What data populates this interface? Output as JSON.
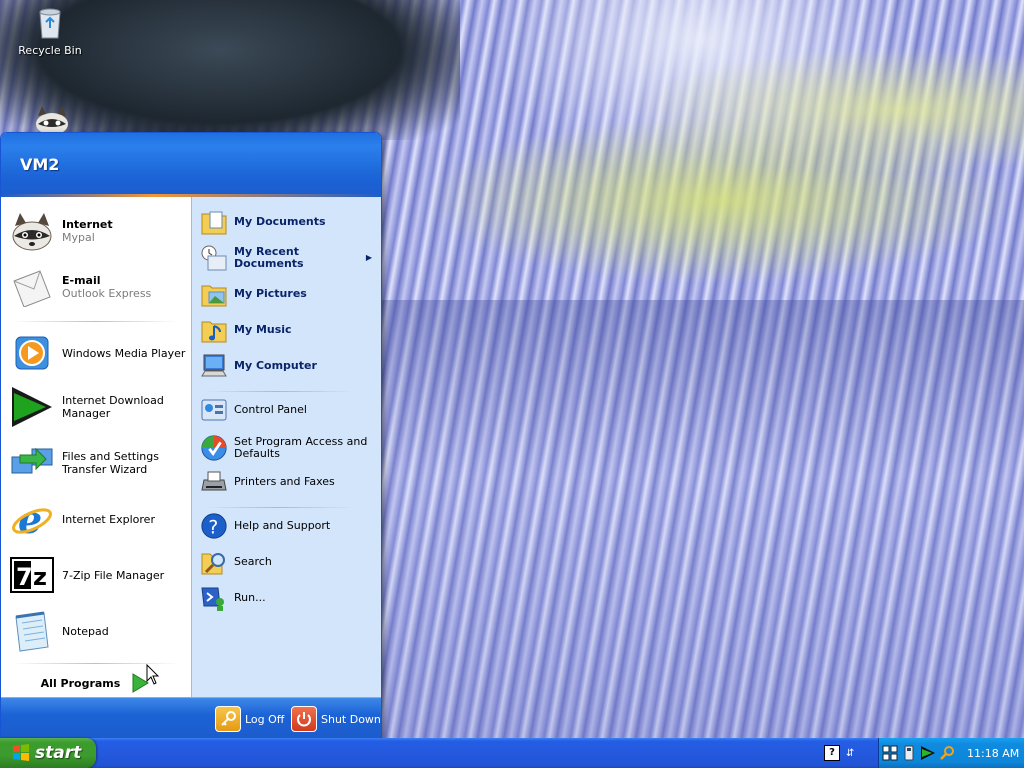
{
  "desktop": {
    "icons": [
      {
        "label": "Recycle Bin",
        "icon": "recycle-bin-icon"
      },
      {
        "label": "",
        "icon": "raccoon-icon"
      }
    ]
  },
  "start_menu": {
    "user_name": "VM2",
    "pinned": [
      {
        "title": "Internet",
        "subtitle": "Mypal",
        "icon": "raccoon-browser-icon"
      },
      {
        "title": "E-mail",
        "subtitle": "Outlook Express",
        "icon": "email-envelope-icon"
      }
    ],
    "recent": [
      {
        "label": "Windows Media Player",
        "icon": "media-player-icon"
      },
      {
        "label": "Internet Download Manager",
        "icon": "download-manager-icon"
      },
      {
        "label": "Files and Settings Transfer Wizard",
        "icon": "transfer-wizard-icon"
      },
      {
        "label": "Internet Explorer",
        "icon": "internet-explorer-icon"
      },
      {
        "label": "7-Zip File Manager",
        "icon": "7zip-icon"
      },
      {
        "label": "Notepad",
        "icon": "notepad-icon"
      }
    ],
    "all_programs_label": "All Programs",
    "places": [
      {
        "label": "My Documents",
        "icon": "documents-folder-icon"
      },
      {
        "label": "My Recent Documents",
        "icon": "recent-documents-icon"
      },
      {
        "label": "My Pictures",
        "icon": "pictures-folder-icon"
      },
      {
        "label": "My Music",
        "icon": "music-folder-icon"
      },
      {
        "label": "My Computer",
        "icon": "computer-icon"
      }
    ],
    "settings": [
      {
        "label": "Control Panel",
        "icon": "control-panel-icon"
      },
      {
        "label": "Set Program Access and Defaults",
        "icon": "program-access-icon"
      },
      {
        "label": "Printers and Faxes",
        "icon": "printer-icon"
      }
    ],
    "help": [
      {
        "label": "Help and Support",
        "icon": "help-icon"
      },
      {
        "label": "Search",
        "icon": "search-icon"
      },
      {
        "label": "Run...",
        "icon": "run-icon"
      }
    ],
    "footer": {
      "log_off": "Log Off",
      "shut_down": "Shut Down"
    }
  },
  "taskbar": {
    "start_label": "start",
    "clock": "11:18 AM"
  },
  "colors": {
    "taskbar_blue": "#245ee5",
    "start_green": "#3c9a2e",
    "menu_header_blue": "#1b63d6",
    "places_pane": "#d3e5fa",
    "tray_blue": "#0f8be0"
  }
}
